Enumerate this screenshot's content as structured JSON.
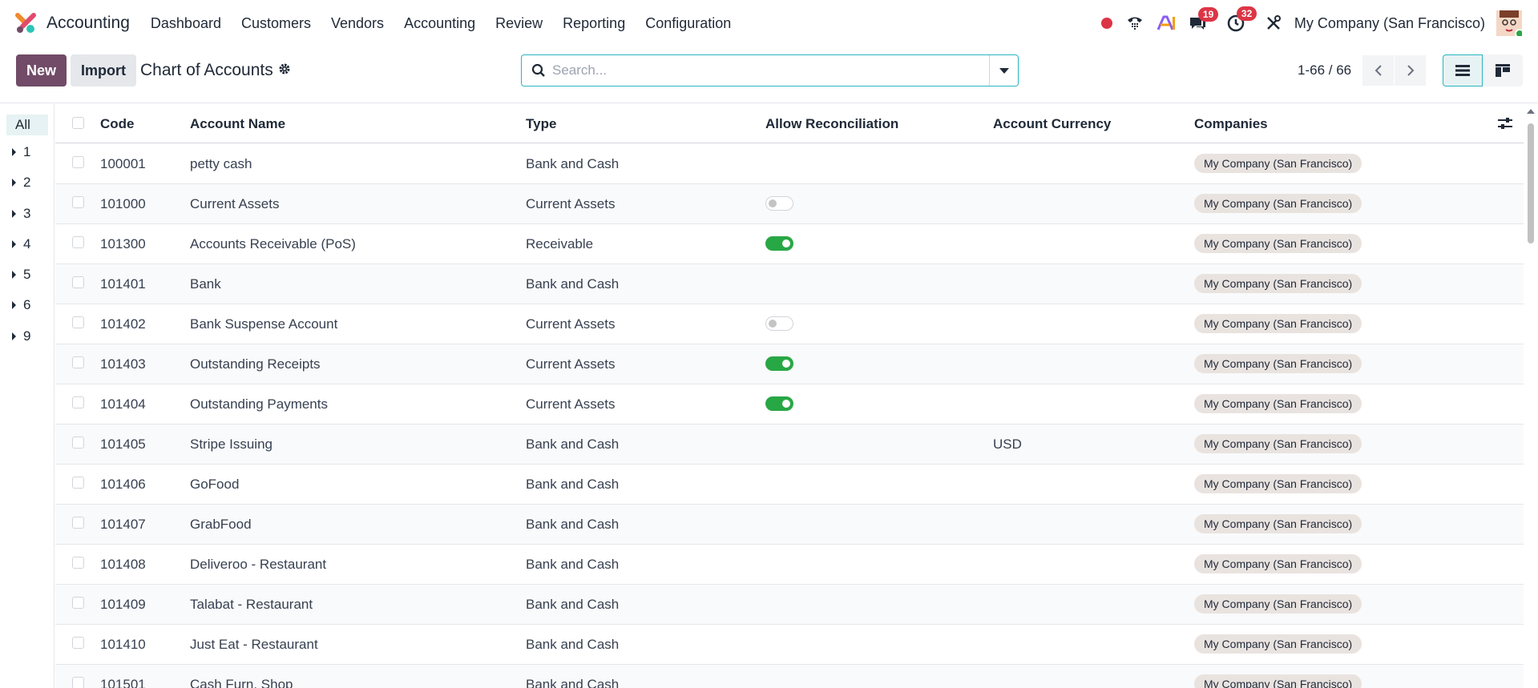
{
  "app": {
    "name": "Accounting"
  },
  "menu": [
    "Dashboard",
    "Customers",
    "Vendors",
    "Accounting",
    "Review",
    "Reporting",
    "Configuration"
  ],
  "systray": {
    "messages_count": "19",
    "activities_count": "32",
    "company": "My Company (San Francisco)"
  },
  "control": {
    "new_label": "New",
    "import_label": "Import",
    "title": "Chart of Accounts",
    "search_placeholder": "Search...",
    "pager": "1-66 / 66"
  },
  "side": {
    "all": "All",
    "groups": [
      "1",
      "2",
      "3",
      "4",
      "5",
      "6",
      "9"
    ]
  },
  "columns": {
    "code": "Code",
    "name": "Account Name",
    "type": "Type",
    "reconcile": "Allow Reconciliation",
    "currency": "Account Currency",
    "companies": "Companies"
  },
  "rows": [
    {
      "code": "100001",
      "name": "petty cash",
      "type": "Bank and Cash",
      "reconcile": "none",
      "currency": "",
      "company": "My Company (San Francisco)"
    },
    {
      "code": "101000",
      "name": "Current Assets",
      "type": "Current Assets",
      "reconcile": "off",
      "currency": "",
      "company": "My Company (San Francisco)"
    },
    {
      "code": "101300",
      "name": "Accounts Receivable (PoS)",
      "type": "Receivable",
      "reconcile": "on",
      "currency": "",
      "company": "My Company (San Francisco)"
    },
    {
      "code": "101401",
      "name": "Bank",
      "type": "Bank and Cash",
      "reconcile": "none",
      "currency": "",
      "company": "My Company (San Francisco)"
    },
    {
      "code": "101402",
      "name": "Bank Suspense Account",
      "type": "Current Assets",
      "reconcile": "off",
      "currency": "",
      "company": "My Company (San Francisco)"
    },
    {
      "code": "101403",
      "name": "Outstanding Receipts",
      "type": "Current Assets",
      "reconcile": "on",
      "currency": "",
      "company": "My Company (San Francisco)"
    },
    {
      "code": "101404",
      "name": "Outstanding Payments",
      "type": "Current Assets",
      "reconcile": "on",
      "currency": "",
      "company": "My Company (San Francisco)"
    },
    {
      "code": "101405",
      "name": "Stripe Issuing",
      "type": "Bank and Cash",
      "reconcile": "none",
      "currency": "USD",
      "company": "My Company (San Francisco)"
    },
    {
      "code": "101406",
      "name": "GoFood",
      "type": "Bank and Cash",
      "reconcile": "none",
      "currency": "",
      "company": "My Company (San Francisco)"
    },
    {
      "code": "101407",
      "name": "GrabFood",
      "type": "Bank and Cash",
      "reconcile": "none",
      "currency": "",
      "company": "My Company (San Francisco)"
    },
    {
      "code": "101408",
      "name": "Deliveroo - Restaurant",
      "type": "Bank and Cash",
      "reconcile": "none",
      "currency": "",
      "company": "My Company (San Francisco)"
    },
    {
      "code": "101409",
      "name": "Talabat - Restaurant",
      "type": "Bank and Cash",
      "reconcile": "none",
      "currency": "",
      "company": "My Company (San Francisco)"
    },
    {
      "code": "101410",
      "name": "Just Eat - Restaurant",
      "type": "Bank and Cash",
      "reconcile": "none",
      "currency": "",
      "company": "My Company (San Francisco)"
    },
    {
      "code": "101501",
      "name": "Cash Furn. Shop",
      "type": "Bank and Cash",
      "reconcile": "none",
      "currency": "",
      "company": "My Company (San Francisco)"
    }
  ],
  "colors": {
    "brand": "#714b67",
    "accent": "#2bb5c1",
    "toggle_on": "#28a745",
    "badge": "#dc3545"
  }
}
